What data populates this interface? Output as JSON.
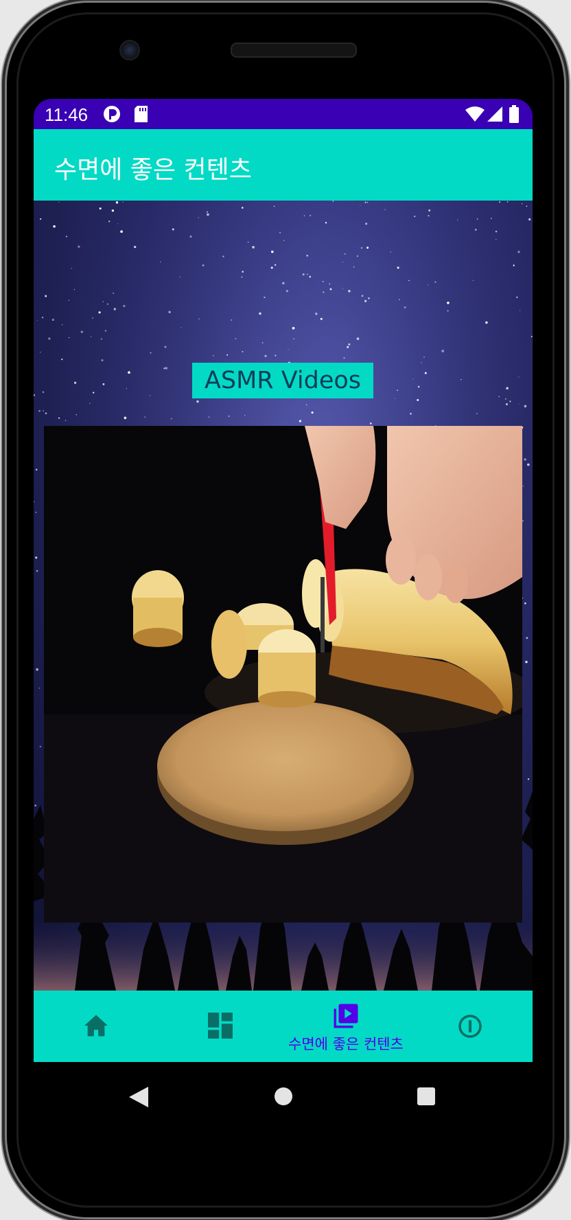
{
  "status_bar": {
    "time": "11:46"
  },
  "app_bar": {
    "title": "수면에 좋은 컨텐츠"
  },
  "content": {
    "section_label": "ASMR Videos",
    "video_description": "video thumbnail: banana being sliced with a red knife on a round cork board"
  },
  "bottom_nav": {
    "items": [
      {
        "icon": "home-icon",
        "label": "",
        "selected": false
      },
      {
        "icon": "dashboard-icon",
        "label": "",
        "selected": false
      },
      {
        "icon": "video-library-icon",
        "label": "수면에 좋은 컨텐츠",
        "selected": true
      },
      {
        "icon": "info-icon",
        "label": "",
        "selected": false
      }
    ]
  },
  "colors": {
    "status_bar": "#3a00b3",
    "accent": "#03dac5",
    "selected_nav": "#5300e8",
    "unselected_nav": "#0a6e66"
  }
}
